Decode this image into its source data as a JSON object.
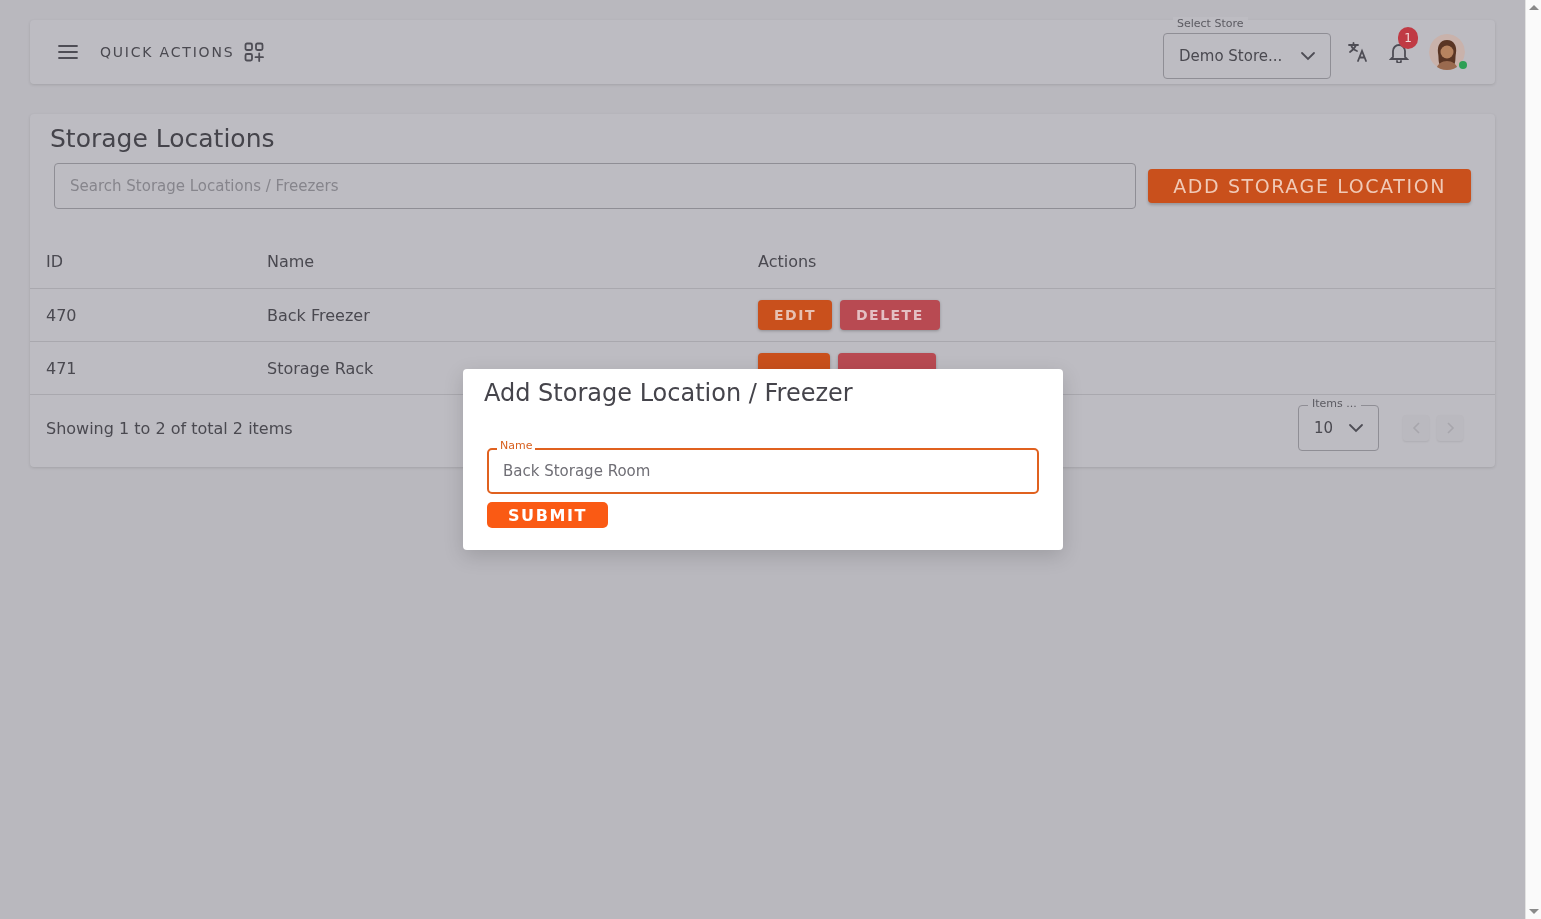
{
  "header": {
    "quick_actions": "QUICK ACTIONS",
    "store_select": {
      "label": "Select Store",
      "value": "Demo Store..."
    },
    "notification_count": "1",
    "user_online": true
  },
  "page": {
    "title": "Storage Locations",
    "search": {
      "placeholder": "Search Storage Locations / Freezers"
    },
    "add_button": "ADD STORAGE LOCATION"
  },
  "table": {
    "columns": [
      "ID",
      "Name",
      "Actions"
    ],
    "rows": [
      {
        "id": "470",
        "name": "Back Freezer",
        "actions": [
          {
            "kind": "edit",
            "label": "EDIT"
          },
          {
            "kind": "delete",
            "label": "DELETE"
          }
        ]
      },
      {
        "id": "471",
        "name": "Storage Rack",
        "actions": [
          {
            "kind": "edit"
          },
          {
            "kind": "delete"
          }
        ]
      }
    ]
  },
  "footer": {
    "summary": "Showing 1 to 2 of total 2 items",
    "page_size": {
      "label": "Items ...",
      "value": "10"
    },
    "pager": [
      {
        "kind": "prev",
        "disabled": true
      },
      {
        "kind": "next",
        "disabled": true
      }
    ]
  },
  "modal": {
    "title": "Add Storage Location / Freezer",
    "field": {
      "label": "Name",
      "value": "Back Storage Room"
    },
    "submit": "SUBMIT"
  }
}
